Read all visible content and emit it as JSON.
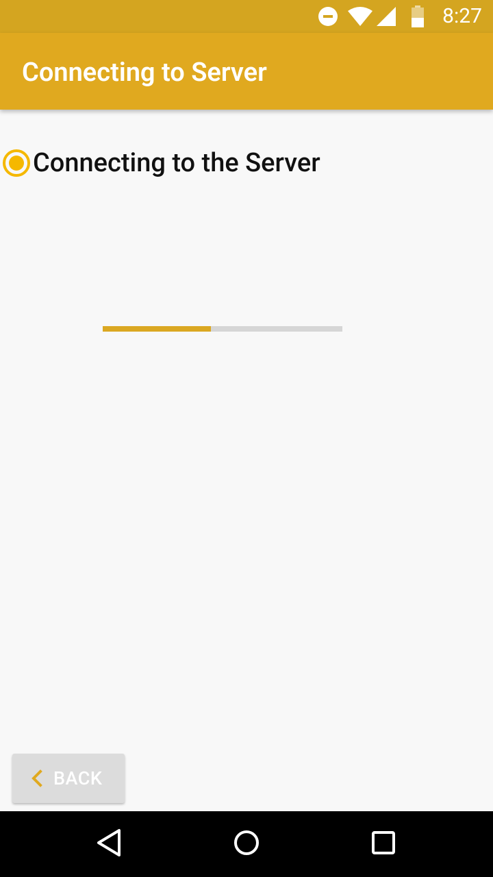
{
  "status_bar": {
    "time": "8:27"
  },
  "app_bar": {
    "title": "Connecting to Server"
  },
  "step": {
    "label": "Connecting to the Server",
    "selected": true
  },
  "progress": {
    "fraction": 0.45
  },
  "back_button": {
    "label": "BACK",
    "icon": "chevron-left-icon"
  },
  "icons": {
    "status": [
      "do-not-disturb-icon",
      "wifi-icon",
      "cell-signal-icon",
      "battery-icon"
    ],
    "nav": [
      "nav-back-icon",
      "nav-home-icon",
      "nav-recents-icon"
    ]
  },
  "colors": {
    "status_bar": "#d4a520",
    "app_bar": "#e0a91f",
    "accent": "#f5b800",
    "progress_fill": "#dba822",
    "progress_track": "#d6d6d6",
    "background": "#f8f8f8"
  }
}
